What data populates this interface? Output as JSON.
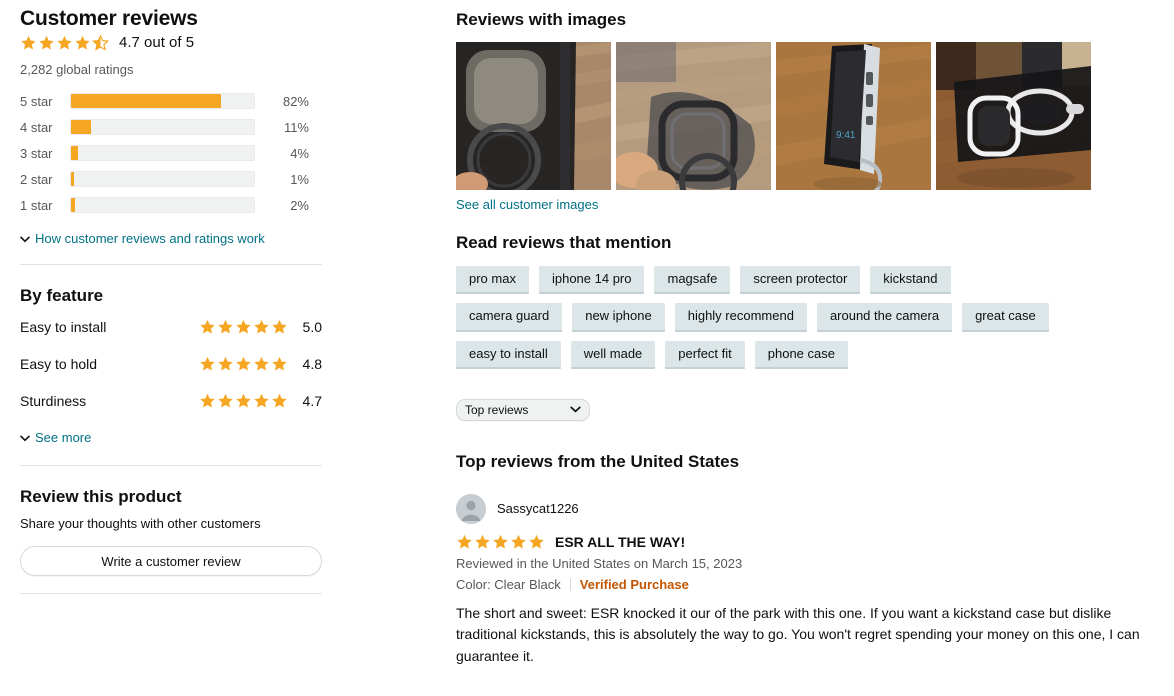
{
  "left": {
    "title": "Customer reviews",
    "overall_stars": 4.5,
    "overall_text": "4.7 out of 5",
    "global_ratings": "2,282 global ratings",
    "histogram": [
      {
        "label": "5 star",
        "pct_text": "82%",
        "pct": 82
      },
      {
        "label": "4 star",
        "pct_text": "11%",
        "pct": 11
      },
      {
        "label": "3 star",
        "pct_text": "4%",
        "pct": 4
      },
      {
        "label": "2 star",
        "pct_text": "1%",
        "pct": 1
      },
      {
        "label": "1 star",
        "pct_text": "2%",
        "pct": 2
      }
    ],
    "how_link": "How customer reviews and ratings work",
    "by_feature_title": "By feature",
    "features": [
      {
        "name": "Easy to install",
        "score": "5.0",
        "stars": 5
      },
      {
        "name": "Easy to hold",
        "score": "4.8",
        "stars": 5
      },
      {
        "name": "Sturdiness",
        "score": "4.7",
        "stars": 5
      }
    ],
    "see_more": "See more",
    "review_product_title": "Review this product",
    "review_product_sub": "Share your thoughts with other customers",
    "write_review_button": "Write a customer review"
  },
  "right": {
    "images_title": "Reviews with images",
    "thumbnails": [
      {
        "alt": "black-phone-case-on-wood-table"
      },
      {
        "alt": "hand-holding-clear-phone-case"
      },
      {
        "alt": "phone-propped-on-kickstand-side-view"
      },
      {
        "alt": "magsafe-case-closeup-on-desk"
      }
    ],
    "see_all_images": "See all customer images",
    "mention_title": "Read reviews that mention",
    "tags": [
      "pro max",
      "iphone 14 pro",
      "magsafe",
      "screen protector",
      "kickstand",
      "camera guard",
      "new iphone",
      "highly recommend",
      "around the camera",
      "great case",
      "easy to install",
      "well made",
      "perfect fit",
      "phone case"
    ],
    "sort_selected": "Top reviews",
    "top_reviews_title": "Top reviews from the United States",
    "review": {
      "author": "Sassycat1226",
      "stars": 5,
      "title": "ESR ALL THE WAY!",
      "date": "Reviewed in the United States on March 15, 2023",
      "color": "Color: Clear Black",
      "verified": "Verified Purchase",
      "body": "The short and sweet: ESR knocked it our of the park with this one. If you want a kickstand case but dislike traditional kickstands, this is absolutely the way to go. You won't regret spending your money on this one, I can guarantee it."
    }
  },
  "colors": {
    "star_orange": "#F5A623",
    "link_teal": "#007185",
    "verified_orange": "#C45500",
    "tag_bg": "#DCE5E8",
    "track_gray": "#F0F2F2"
  }
}
